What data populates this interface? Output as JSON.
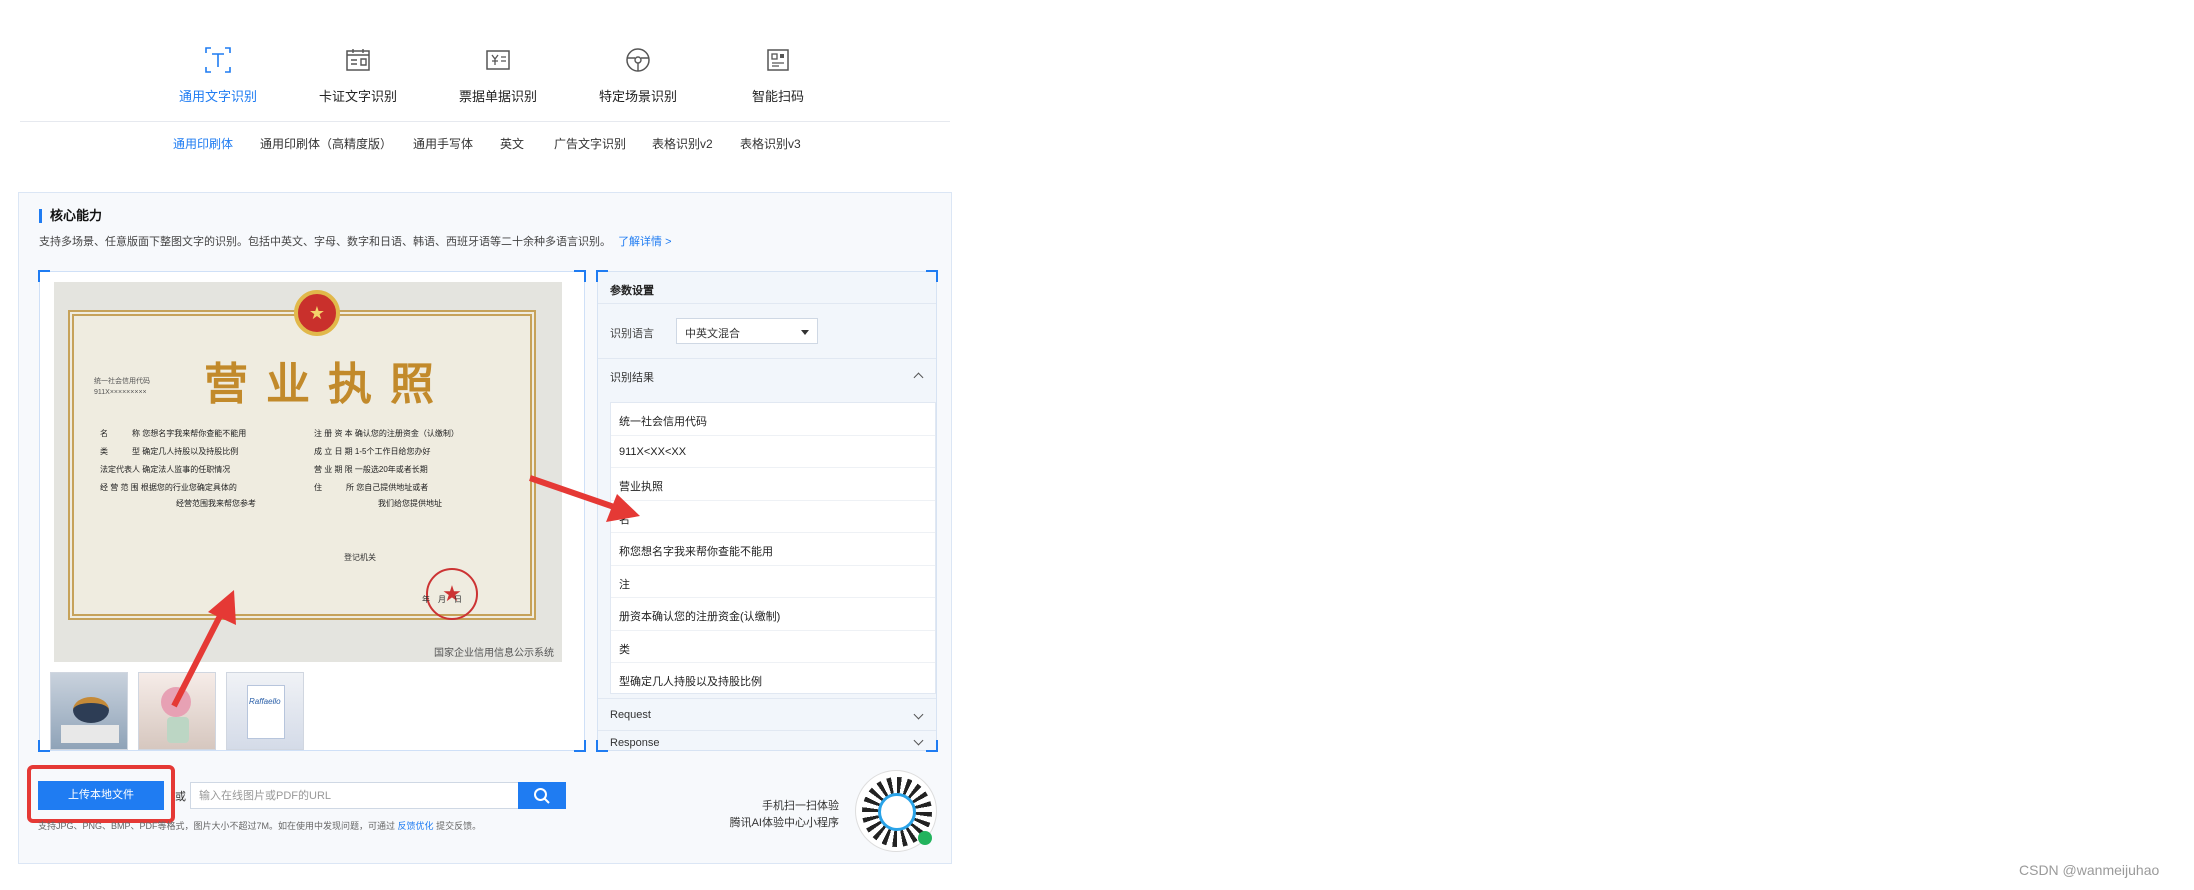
{
  "categories": [
    {
      "label": "通用文字识别",
      "icon": "text-recognition-icon",
      "active": true
    },
    {
      "label": "卡证文字识别",
      "icon": "id-card-icon",
      "active": false
    },
    {
      "label": "票据单据识别",
      "icon": "receipt-icon",
      "active": false
    },
    {
      "label": "特定场景识别",
      "icon": "steering-wheel-icon",
      "active": false
    },
    {
      "label": "智能扫码",
      "icon": "qr-scan-icon",
      "active": false
    }
  ],
  "subtabs": [
    {
      "label": "通用印刷体",
      "active": true
    },
    {
      "label": "通用印刷体（高精度版）",
      "active": false
    },
    {
      "label": "通用手写体",
      "active": false
    },
    {
      "label": "英文",
      "active": false
    },
    {
      "label": "广告文字识别",
      "active": false
    },
    {
      "label": "表格识别v2",
      "active": false
    },
    {
      "label": "表格识别v3",
      "active": false
    }
  ],
  "core": {
    "title": "核心能力",
    "description": "支持多场景、任意版面下整图文字的识别。包括中英文、字母、数字和日语、韩语、西班牙语等二十余种多语言识别。",
    "more_link": "了解详情 >"
  },
  "license": {
    "title": "营业执照",
    "code_label": "统一社会信用代码",
    "code_value": "911X×××××××××",
    "fields": [
      "名　　　称  您想名字我来帮你查能不能用",
      "类　　　型  确定几人持股以及持股比例",
      "法定代表人  确定法人监事的任职情况",
      "经 营 范 围  根据您的行业您确定具体的",
      "经营范围我来帮您参考",
      "注 册 资 本  确认您的注册资金（认缴制）",
      "成 立 日 期  1-5个工作日给您办好",
      "营 业 期 限  一般选20年或者长期",
      "住　　　所  您自己提供地址或者",
      "我们给您提供地址"
    ],
    "registrar": "登记机关",
    "date": "年　月　日",
    "caption": "国家企业信用信息公示系统"
  },
  "params": {
    "header": "参数设置",
    "lang_label": "识别语言",
    "lang_value": "中英文混合",
    "results_label": "识别结果",
    "results": [
      "统一社会信用代码",
      "911X<XX<XX",
      "营业执照",
      "名",
      "称您想名字我来帮你查能不能用",
      "注",
      "册资本确认您的注册资金(认缴制)",
      "类",
      "型确定几人持股以及持股比例"
    ],
    "request_label": "Request",
    "response_label": "Response"
  },
  "controls": {
    "upload_label": "上传本地文件",
    "url_label": "或",
    "url_placeholder": "输入在线图片或PDF的URL",
    "notice_prefix": "支持JPG、PNG、BMP、PDF等格式，图片大小不超过7M。如在使用中发现问题，可通过",
    "notice_link": "反馈优化",
    "notice_suffix": "提交反馈。"
  },
  "mini_program": {
    "line1": "手机扫一扫体验",
    "line2": "腾讯AI体验中心小程序"
  },
  "watermark": "CSDN @wanmeijuhao",
  "colors": {
    "accent": "#1f7cf2",
    "highlight": "#e53935"
  }
}
